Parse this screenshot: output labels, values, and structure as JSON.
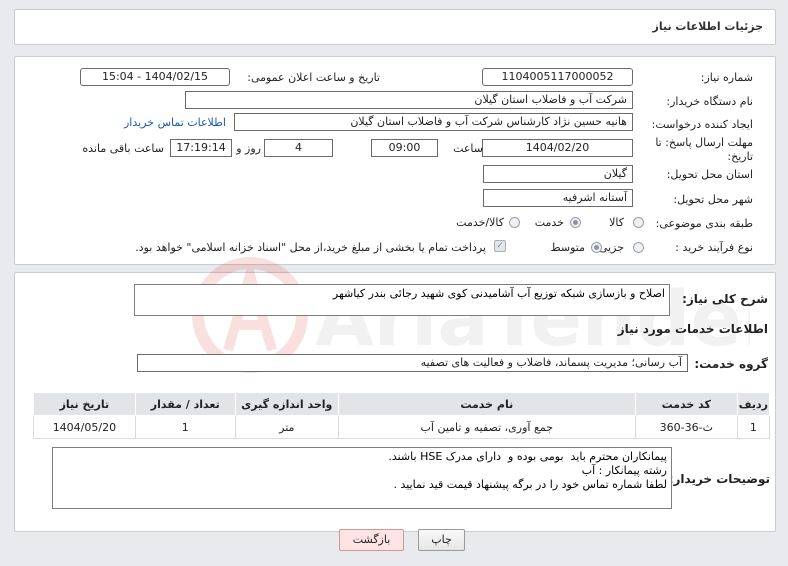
{
  "page": {
    "title": "جزئیات اطلاعات نیاز"
  },
  "form": {
    "need_number_label": "شماره نیاز:",
    "need_number": "1104005117000052",
    "announce_label": "تاریخ و ساعت اعلان عمومی:",
    "announce_value": "1404/02/15 - 15:04",
    "buyer_org_label": "نام دستگاه خریدار:",
    "buyer_org": "شرکت آب و فاضلاب استان گیلان",
    "creator_label": "ایجاد کننده درخواست:",
    "creator": "هانیه حسین نژاد کارشناس شرکت آب و فاضلاب استان گیلان",
    "contact_link": "اطلاعات تماس خریدار",
    "deadline_label": "مهلت ارسال پاسخ: تا تاریخ:",
    "deadline_date": "1404/02/20",
    "time_label": "ساعت",
    "deadline_time": "09:00",
    "days_value": "4",
    "days_label": "روز و",
    "remaining_time": "17:19:14",
    "remaining_label": "ساعت باقی مانده",
    "province_label": "استان محل تحویل:",
    "province": "گیلان",
    "city_label": "شهر محل تحویل:",
    "city": "آستانه اشرفیه",
    "category_label": "طبقه بندی موضوعی:",
    "category_options": [
      "کالا",
      "خدمت",
      "کالا/خدمت"
    ],
    "category_selected": "خدمت",
    "process_label": "نوع فرآیند خرید :",
    "process_options": [
      "جزیی",
      "متوسط"
    ],
    "process_selected": "متوسط",
    "payment_note": "پرداخت تمام یا بخشی از مبلغ خرید،از محل \"اسناد خزانه اسلامی\" خواهد بود."
  },
  "summary": {
    "label": "شرح کلی نیاز:",
    "text": "اصلاح و بازسازی شبکه توزیع آب آشامیدنی کوی شهید رجائی بندر کیاشهر"
  },
  "services": {
    "section_title": "اطلاعات خدمات مورد نیاز",
    "group_label": "گروه خدمت:",
    "group_value": "آب رسانی؛ مدیریت پسماند، فاضلاب و فعالیت های تصفیه",
    "columns": [
      "ردیف",
      "کد خدمت",
      "نام خدمت",
      "واحد اندازه گیری",
      "تعداد / مقدار",
      "تاریخ نیاز"
    ],
    "rows": [
      [
        "1",
        "ث-36-360",
        "جمع آوری، تصفیه و تامین آب",
        "متر",
        "1",
        "1404/05/20"
      ]
    ]
  },
  "buyer_notes": {
    "label": "توضیحات خریدار:",
    "text": "پیمانکاران محترم باید  بومی بوده و  دارای مدرک HSE باشند.\nرشته پیمانکار : آب\nلطفا شماره تماس خود را در برگه پیشنهاد قیمت قید نمایید ."
  },
  "buttons": {
    "print": "چاپ",
    "back": "بازگشت"
  },
  "watermark": {
    "text": "AriaTender.neT"
  },
  "colors": {
    "link": "#1a57b8",
    "header_bg": "#e3e4e7",
    "back_button": "#fde3e3",
    "page_bg": "#e9eaee"
  }
}
